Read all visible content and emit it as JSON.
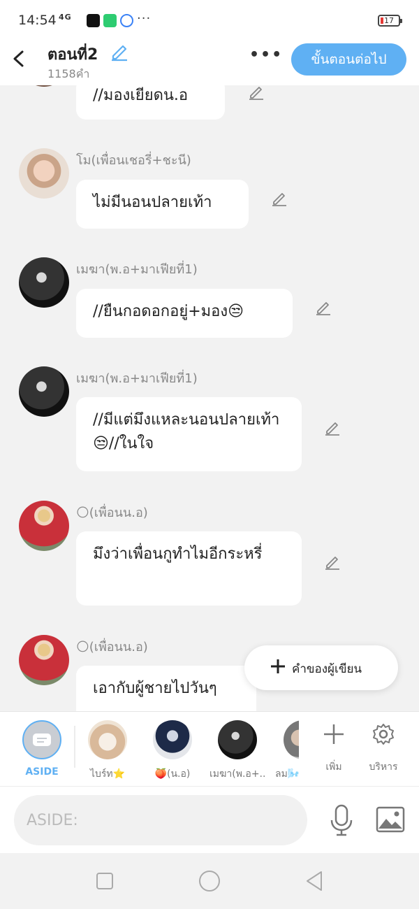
{
  "status_bar": {
    "time": "14:54",
    "signal": "4G",
    "battery": "17"
  },
  "header": {
    "title": "ตอนที่2",
    "word_count": "1158คำ",
    "next_label": "ขั้นตอนต่อไป",
    "more_label": "•••"
  },
  "messages": [
    {
      "name": "",
      "text": "//มองเยียดน.อ",
      "avatar": "partial"
    },
    {
      "name": "โม(เพื่อนเชอรี่+ชะนี)",
      "text": "ไม่มีนอนปลายเท้า",
      "avatar": "girl"
    },
    {
      "name": "เมฆา(พ.อ+มาเฟียที่1)",
      "text": "//ยืนกอดอกอยู่+มอง😒",
      "avatar": "dark-couple"
    },
    {
      "name": "เมฆา(พ.อ+มาเฟียที่1)",
      "text": "//มีแต่มึงแหละนอนปลายเท้า😒//ในใจ",
      "avatar": "dark-couple"
    },
    {
      "name": "🌕(เพื่อนน.อ)",
      "text": "มึงว่าเพื่อนกูทำไมอีกระหรี่",
      "avatar": "red-shirt"
    },
    {
      "name": "🌕(เพื่อนน.อ)",
      "text": "เอากับผู้ชายไปวันๆ",
      "avatar": "red-shirt"
    }
  ],
  "fab": {
    "label": "คำของผู้เขียน"
  },
  "characters": [
    {
      "label": "ASIDE"
    },
    {
      "label": "ไบร์ท⭐"
    },
    {
      "label": "🍑(น.อ)"
    },
    {
      "label": "เมฆา(พ.อ+..."
    },
    {
      "label": "ลม🌬️"
    }
  ],
  "actions": {
    "add_label": "เพิ่ม",
    "manage_label": "บริหาร"
  },
  "input": {
    "placeholder": "ASIDE:"
  },
  "colors": {
    "accent": "#5fb0f3",
    "bubble": "#ffffff",
    "background": "#f2f2f2"
  }
}
